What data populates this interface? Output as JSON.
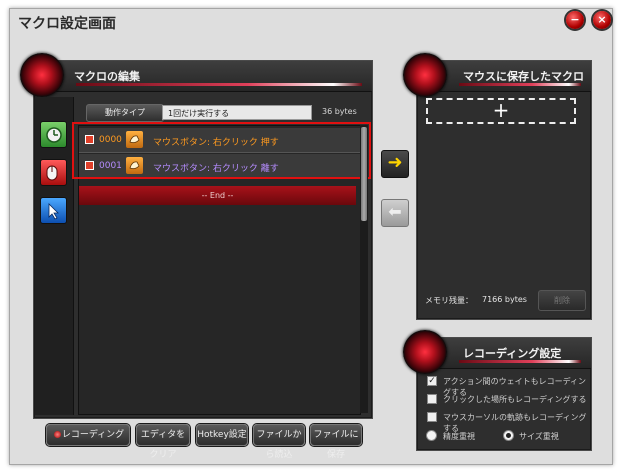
{
  "window": {
    "title": "マクロ設定画面",
    "minimize_glyph": "−",
    "close_glyph": "×"
  },
  "macro_editor": {
    "title": "マクロの編集",
    "action_type_label": "動作タイプ",
    "repeat_mode": "1回だけ実行する",
    "size": "36 bytes",
    "tools": [
      "delay-icon",
      "mouse-button-icon",
      "cursor-icon"
    ],
    "rows": [
      {
        "index": "0000",
        "action": "マウスボタン:  右クリック  押す",
        "color": "#ff9a1f"
      },
      {
        "index": "0001",
        "action": "マウスボタン:  右クリック  離す",
        "color": "#b58cff"
      }
    ],
    "end_label": "-- End --"
  },
  "arrows": {
    "right": "➜",
    "left": "⬅"
  },
  "saved_macros": {
    "title": "マウスに保存したマクロ",
    "add_glyph": "+",
    "memory_label": "メモリ残量：",
    "memory_value": "7166 bytes",
    "delete_label": "削除"
  },
  "recording_settings": {
    "title": "レコーディング設定",
    "options": [
      {
        "label": "アクション間のウェイトもレコーディングする",
        "checked": true
      },
      {
        "label": "クリックした場所もレコーディングする",
        "checked": false
      },
      {
        "label": "マウスカーソルの軌跡もレコーディングする",
        "checked": false
      }
    ],
    "radios": [
      {
        "label": "精度重視",
        "selected": false
      },
      {
        "label": "サイズ重視",
        "selected": true
      }
    ]
  },
  "bottom_buttons": {
    "record": "レコーディング",
    "clear": "エディタをクリア",
    "hotkey": "Hotkey設定",
    "load": "ファイルから読込",
    "save": "ファイルに保存"
  },
  "colors": {
    "accent": "#d0101e",
    "highlight_frame": "#e01010",
    "end_bar": "#8a0d12"
  }
}
